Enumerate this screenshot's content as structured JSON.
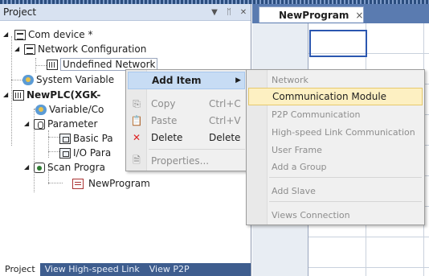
{
  "panel": {
    "title": "Project",
    "tree": {
      "com_device": "Com device *",
      "network_configuration": "Network Configuration",
      "undefined_network": "Undefined Network",
      "system_variable": "System Variable",
      "plc": "NewPLC(XGK-",
      "variable_comment": "Variable/Co",
      "parameter": "Parameter",
      "basic_parameter": "Basic Pa",
      "io_parameter": "I/O Para",
      "scan_program": "Scan Progra",
      "new_program": "NewProgram"
    },
    "bottom_tabs": [
      "Project",
      "View High-speed Link",
      "View P2P"
    ]
  },
  "editor": {
    "tab_label": "NewProgram",
    "tab_close": "×"
  },
  "context_menu": {
    "add_item": "Add Item",
    "copy": "Copy",
    "copy_shortcut": "Ctrl+C",
    "paste": "Paste",
    "paste_shortcut": "Ctrl+V",
    "delete": "Delete",
    "delete_shortcut": "Delete",
    "properties": "Properties..."
  },
  "submenu": {
    "network": "Network",
    "communication_module": "Communication Module",
    "p2p_communication": "P2P Communication",
    "high_speed_link": "High-speed Link Communication",
    "user_frame": "User Frame",
    "add_group": "Add a Group",
    "add_slave": "Add Slave",
    "views_connection": "Views Connection"
  },
  "colors": {
    "highlight_menu": "#c7dcf4",
    "highlight_submenu": "#fdf0c2",
    "panel_header": "#d8e2f1",
    "tab_strip": "#3e5d8e",
    "editor_bg": "#5a7bb0"
  }
}
